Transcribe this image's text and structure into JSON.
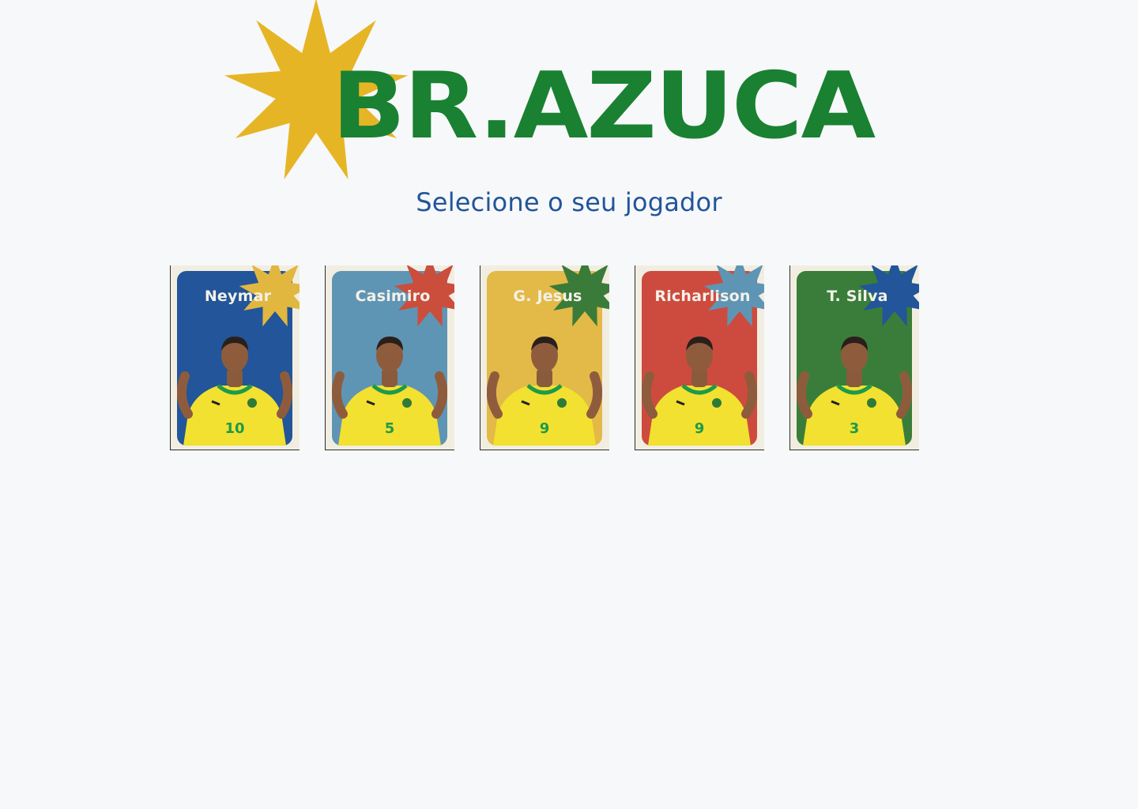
{
  "brand": {
    "name": "BR.AZUCA",
    "text_color": "#198131",
    "star_color": "#e6b526"
  },
  "subtitle": "Selecione o seu jogador",
  "subtitle_color": "#21559a",
  "players": [
    {
      "name": "Neymar",
      "panel_color": "#22559a",
      "burst_color": "#e2b73f",
      "number": "10",
      "icon": "player-photo"
    },
    {
      "name": "Casimiro",
      "panel_color": "#5f95b4",
      "burst_color": "#cb4d3c",
      "number": "5",
      "icon": "player-photo"
    },
    {
      "name": "G. Jesus",
      "panel_color": "#e3b947",
      "burst_color": "#3a7b39",
      "number": "9",
      "icon": "player-photo"
    },
    {
      "name": "Richarlison",
      "panel_color": "#cd4b3e",
      "burst_color": "#5f95b4",
      "number": "9",
      "icon": "player-photo"
    },
    {
      "name": "T. Silva",
      "panel_color": "#3a7d3a",
      "burst_color": "#22559a",
      "number": "3",
      "icon": "player-photo"
    }
  ]
}
